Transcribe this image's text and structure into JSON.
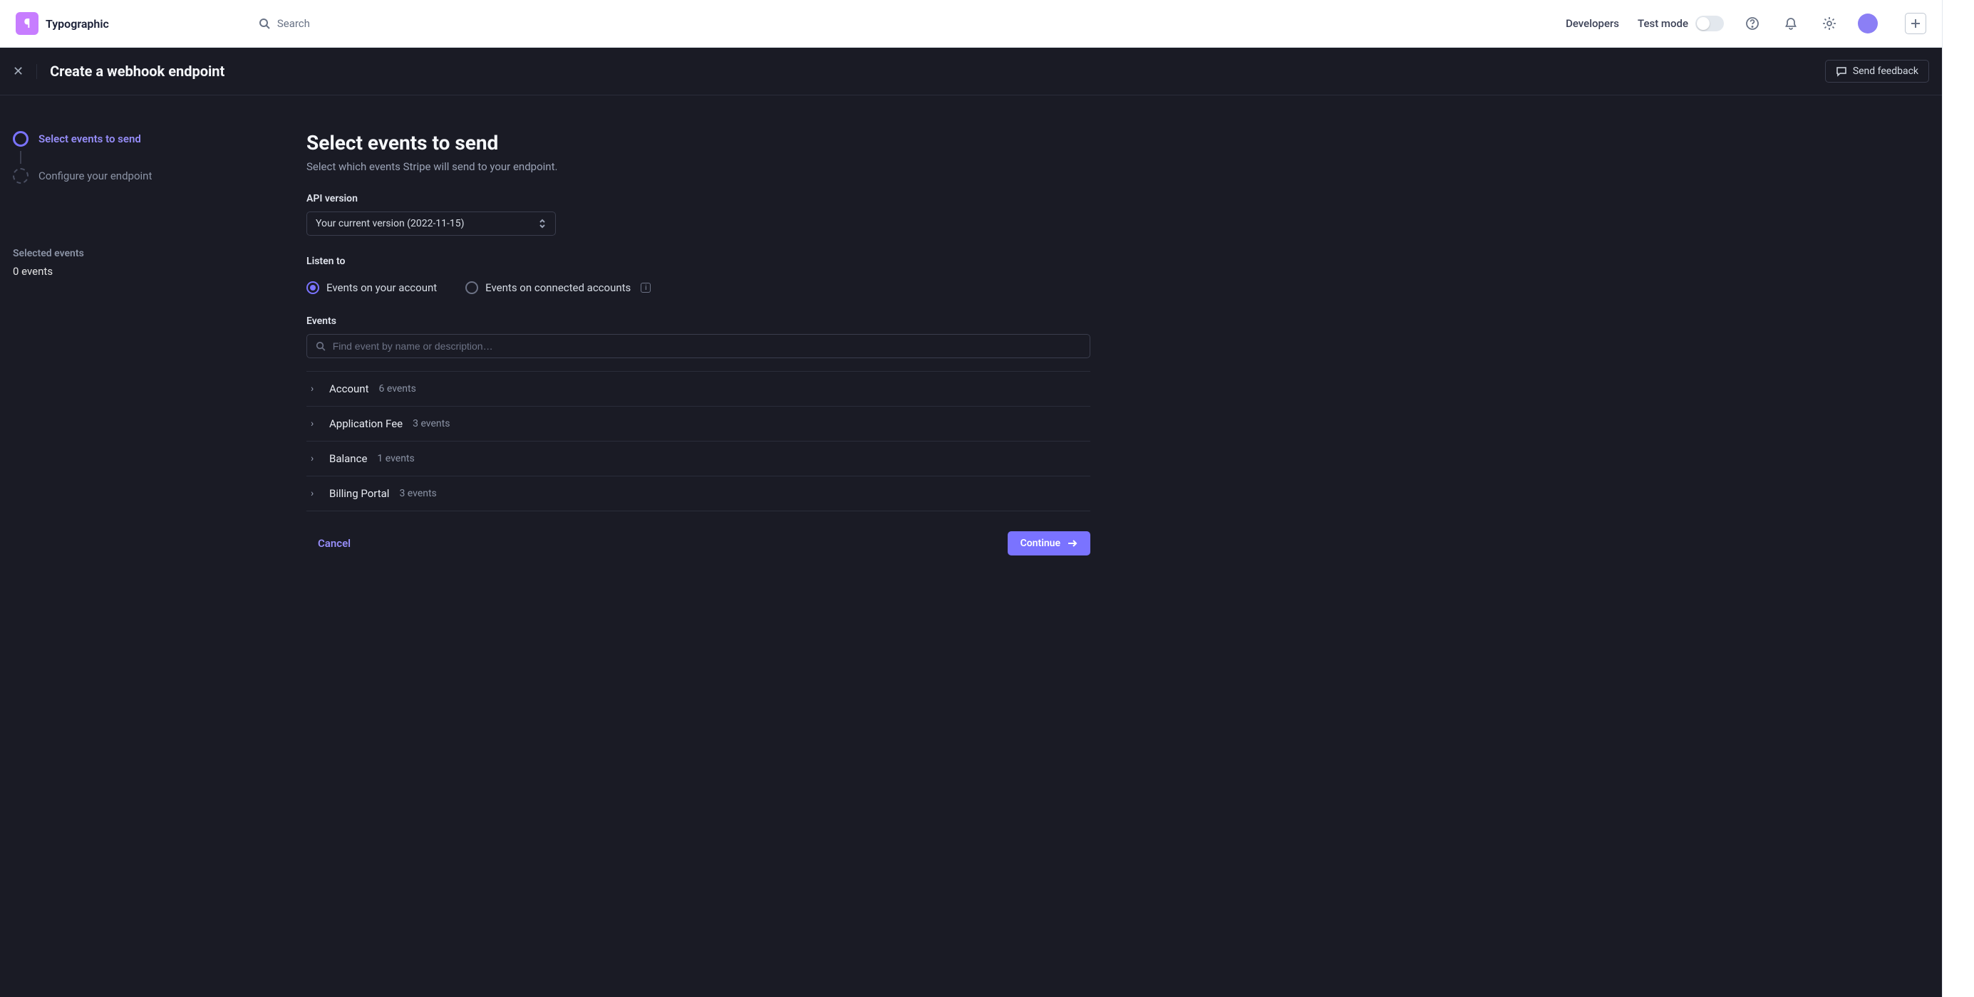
{
  "brand": {
    "name": "Typographic",
    "logo_glyph": "¶"
  },
  "topnav": {
    "search_placeholder": "Search",
    "developers": "Developers",
    "test_mode": "Test mode"
  },
  "subheader": {
    "title": "Create a webhook endpoint",
    "feedback": "Send feedback"
  },
  "steps": {
    "items": [
      {
        "label": "Select events to send",
        "active": true
      },
      {
        "label": "Configure your endpoint",
        "active": false
      }
    ],
    "selected_label": "Selected events",
    "selected_value": "0 events"
  },
  "form": {
    "heading": "Select events to send",
    "description": "Select which events Stripe will send to your endpoint.",
    "api_version_label": "API version",
    "api_version_value": "Your current version (2022-11-15)",
    "listen_label": "Listen to",
    "listen_options": [
      {
        "label": "Events on your account",
        "checked": true
      },
      {
        "label": "Events on connected accounts",
        "checked": false,
        "info": true
      }
    ],
    "events_label": "Events",
    "events_search_placeholder": "Find event by name or description…",
    "event_categories": [
      {
        "name": "Account",
        "count": "6 events"
      },
      {
        "name": "Application Fee",
        "count": "3 events"
      },
      {
        "name": "Balance",
        "count": "1 events"
      },
      {
        "name": "Billing Portal",
        "count": "3 events"
      }
    ],
    "cancel": "Cancel",
    "continue": "Continue"
  }
}
